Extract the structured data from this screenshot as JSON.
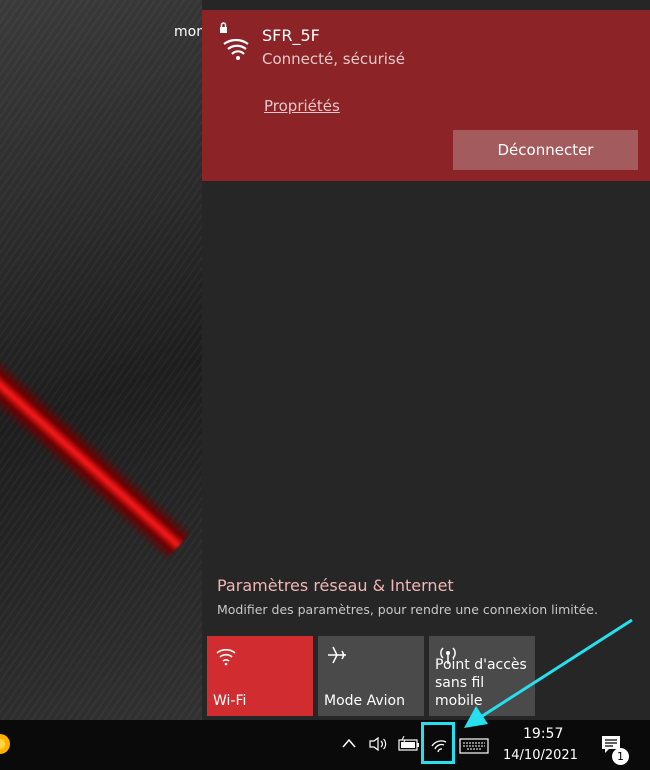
{
  "desktop": {
    "partial_text": "mon"
  },
  "network": {
    "name": "SFR_5F",
    "status": "Connecté, sécurisé",
    "properties_label": "Propriétés",
    "disconnect_label": "Déconnecter"
  },
  "settings": {
    "link_label": "Paramètres réseau & Internet",
    "description": "Modifier des paramètres, pour rendre une connexion limitée."
  },
  "tiles": [
    {
      "label": "Wi-Fi",
      "icon": "wifi-icon",
      "active": true
    },
    {
      "label": "Mode Avion",
      "icon": "airplane-icon",
      "active": false
    },
    {
      "label_line1": "Point d'accès",
      "label_line2": "sans fil mobile",
      "icon": "hotspot-icon",
      "active": false
    }
  ],
  "taskbar": {
    "time": "19:57",
    "date": "14/10/2021",
    "notification_count": "1"
  },
  "colors": {
    "accent": "#8b2327",
    "tile_active": "#d12c2f",
    "highlight": "#26e0f0"
  }
}
